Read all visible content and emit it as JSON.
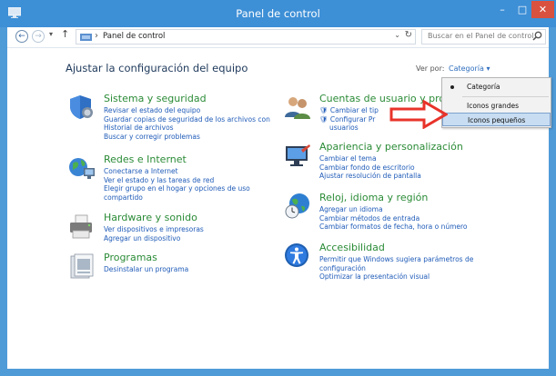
{
  "window": {
    "title": "Panel de control",
    "controls": {
      "minimize": "–",
      "maximize": "□",
      "close": "✕"
    },
    "colors": {
      "titlebar": "#3d8fd6",
      "close": "#d9513f"
    }
  },
  "addressbar": {
    "path": "Panel de control",
    "search_placeholder": "Buscar en el Panel de control",
    "icons": [
      "back-icon",
      "forward-icon",
      "recent-icon",
      "up-icon",
      "folder-icon",
      "refresh-icon",
      "search-icon"
    ]
  },
  "main": {
    "heading": "Ajustar la configuración del equipo",
    "viewby_label": "Ver por:",
    "viewby_value": "Categoría ▾"
  },
  "categories": [
    {
      "title": "Sistema y seguridad",
      "icon": "shield-icon",
      "links": [
        "Revisar el estado del equipo",
        "Guardar copias de seguridad de los archivos con",
        "Historial de archivos",
        "Buscar y corregir problemas"
      ]
    },
    {
      "title": "Redes e Internet",
      "icon": "network-globe-icon",
      "links": [
        "Conectarse a Internet",
        "Ver el estado y las tareas de red",
        "Elegir grupo en el hogar y opciones de uso",
        "compartido"
      ]
    },
    {
      "title": "Hardware y sonido",
      "icon": "printer-icon",
      "links": [
        "Ver dispositivos e impresoras",
        "Agregar un dispositivo"
      ]
    },
    {
      "title": "Programas",
      "icon": "programs-icon",
      "links": [
        "Desinstalar un programa"
      ]
    },
    {
      "title": "Cuentas de usuario y protecc",
      "icon": "users-icon",
      "links": [
        "Cambiar el tip",
        "Configurar Pr",
        "usuarios"
      ]
    },
    {
      "title": "Apariencia y personalización",
      "icon": "display-icon",
      "links": [
        "Cambiar el tema",
        "Cambiar fondo de escritorio",
        "Ajustar resolución de pantalla"
      ]
    },
    {
      "title": "Reloj, idioma y región",
      "icon": "clock-globe-icon",
      "links": [
        "Agregar un idioma",
        "Cambiar métodos de entrada",
        "Cambiar formatos de fecha, hora o número"
      ]
    },
    {
      "title": "Accesibilidad",
      "icon": "accessibility-icon",
      "links": [
        "Permitir que Windows sugiera parámetros de",
        "configuración",
        "Optimizar la presentación visual"
      ]
    }
  ],
  "dropdown": {
    "items": [
      {
        "label": "Categoría",
        "selected": true
      },
      {
        "label": "Iconos grandes",
        "selected": false
      },
      {
        "label": "Iconos pequeños",
        "selected": false,
        "highlighted": true
      }
    ]
  },
  "annotation": {
    "icon": "red-arrow-icon",
    "color": "#e8332a"
  }
}
